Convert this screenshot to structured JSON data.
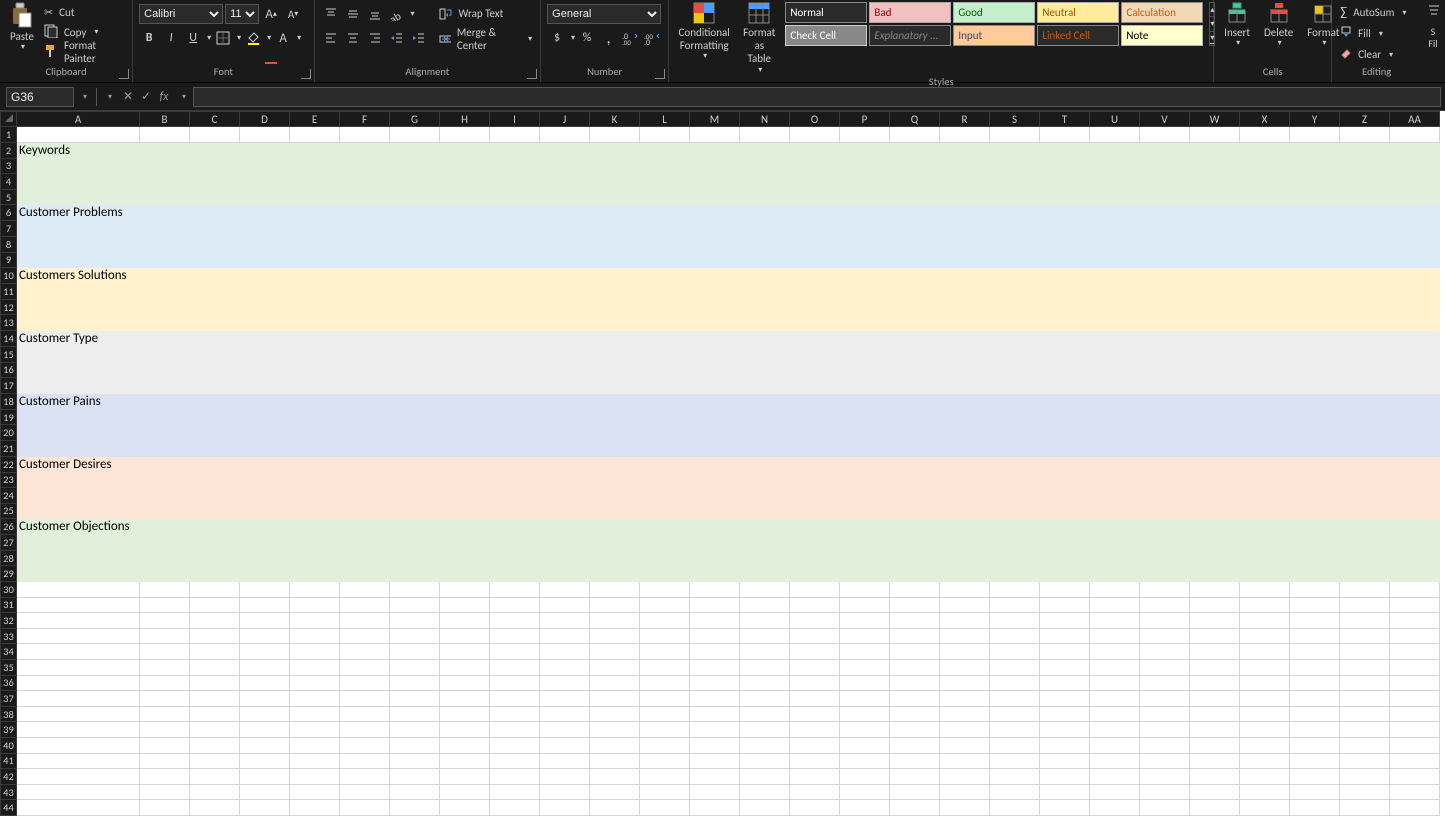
{
  "clipboard": {
    "cut": "Cut",
    "copy": "Copy",
    "fmtpainter": "Format Painter",
    "paste": "Paste",
    "label": "Clipboard"
  },
  "font": {
    "name": "Calibri",
    "size": "11",
    "label": "Font"
  },
  "alignment": {
    "wrap": "Wrap Text",
    "merge": "Merge & Center",
    "label": "Alignment"
  },
  "number": {
    "fmt": "General",
    "label": "Number"
  },
  "condfmt": "Conditional\nFormatting",
  "fmtas": "Format as\nTable",
  "styles": {
    "label": "Styles",
    "cells": [
      {
        "t": "Normal",
        "bg": "#2a2a2a",
        "fg": "#fff",
        "bd": "#888"
      },
      {
        "t": "Bad",
        "bg": "#f2c0c0",
        "fg": "#9c0006",
        "bd": "#aaa"
      },
      {
        "t": "Good",
        "bg": "#c6efce",
        "fg": "#006100",
        "bd": "#aaa"
      },
      {
        "t": "Neutral",
        "bg": "#ffeb9c",
        "fg": "#9c5700",
        "bd": "#aaa"
      },
      {
        "t": "Calculation",
        "bg": "#f2d9b3",
        "fg": "#c65911",
        "bd": "#888"
      },
      {
        "t": "Check Cell",
        "bg": "#888",
        "fg": "#fff",
        "bd": "#ccc"
      },
      {
        "t": "Explanatory ...",
        "bg": "#2a2a2a",
        "fg": "#888",
        "bd": "#888",
        "it": true
      },
      {
        "t": "Input",
        "bg": "#ffcc99",
        "fg": "#3f3f76",
        "bd": "#888"
      },
      {
        "t": "Linked Cell",
        "bg": "#2a2a2a",
        "fg": "#c65911",
        "bd": "#888"
      },
      {
        "t": "Note",
        "bg": "#ffffcc",
        "fg": "#000",
        "bd": "#b2b2b2"
      }
    ]
  },
  "cells": {
    "insert": "Insert",
    "delete": "Delete",
    "format": "Format",
    "label": "Cells"
  },
  "editing": {
    "autosum": "AutoSum",
    "fill": "Fill",
    "clear": "Clear",
    "label": "Editing"
  },
  "namebox": "G36",
  "columns": [
    "A",
    "B",
    "C",
    "D",
    "E",
    "F",
    "G",
    "H",
    "I",
    "J",
    "K",
    "L",
    "M",
    "N",
    "O",
    "P",
    "Q",
    "R",
    "S",
    "T",
    "U",
    "V",
    "W",
    "X",
    "Y",
    "Z",
    "AA"
  ],
  "bands": [
    {
      "row": 2,
      "text": "Keywords",
      "bg": "#e2efda"
    },
    {
      "row": 6,
      "text": "Customer Problems",
      "bg": "#ddebf7"
    },
    {
      "row": 10,
      "text": "Customers Solutions",
      "bg": "#fff2cc"
    },
    {
      "row": 14,
      "text": "Customer Type",
      "bg": "#ededed"
    },
    {
      "row": 18,
      "text": "Customer Pains",
      "bg": "#d9e1f2"
    },
    {
      "row": 22,
      "text": "Customer Desires",
      "bg": "#fce4d6"
    },
    {
      "row": 26,
      "text": "Customer Objections",
      "bg": "#e2efda"
    }
  ],
  "total_rows": 44
}
